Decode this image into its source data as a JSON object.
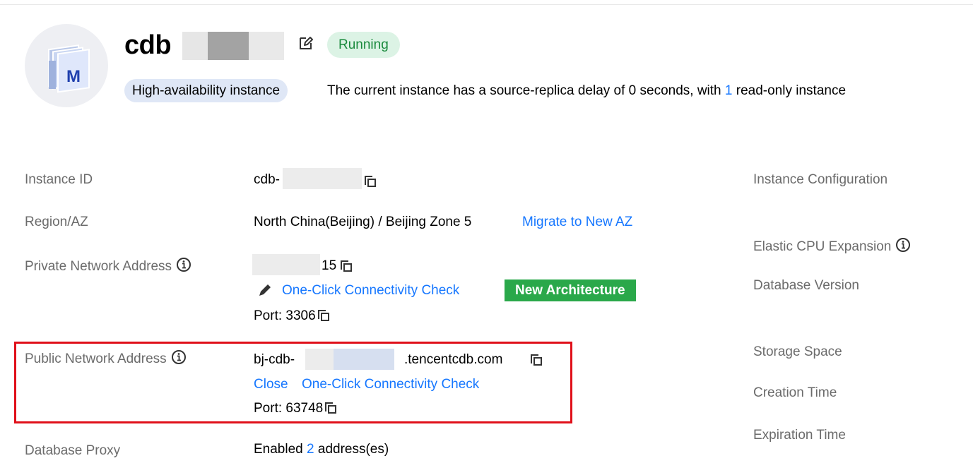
{
  "instance": {
    "name": "cdb",
    "status": "Running",
    "type_tag": "High-availability instance",
    "summary": {
      "text_before": "The current instance has a source-replica delay of  0  seconds, with ",
      "readonly_count": "1",
      "text_after": "  read-only instance"
    },
    "logo_letter": "M"
  },
  "details": {
    "instance_id": {
      "label": "Instance ID",
      "value": "cdb-"
    },
    "region": {
      "label": "Region/AZ",
      "value": "North China(Beijing) / Beijing Zone 5",
      "link": "Migrate to New AZ"
    },
    "private_network": {
      "label": "Private Network Address",
      "address_suffix": "15",
      "connectivity_link": "One-Click Connectivity Check",
      "badge": "New Architecture",
      "port": "Port: 3306"
    },
    "public_network": {
      "label": "Public Network Address",
      "address_prefix": "bj-cdb-",
      "address_suffix": ".tencentcdb.com",
      "close_link": "Close",
      "connectivity_link": "One-Click Connectivity Check",
      "port": "Port: 63748"
    },
    "database_proxy": {
      "label": "Database Proxy",
      "value_prefix": "Enabled",
      "count": "2",
      "value_suffix": "address(es)"
    }
  },
  "right_column": {
    "instance_configuration": "Instance Configuration",
    "elastic_cpu": "Elastic CPU Expansion",
    "database_version": "Database Version",
    "storage_space": "Storage Space",
    "creation_time": "Creation Time",
    "expiration_time": "Expiration Time"
  },
  "colors": {
    "accent_link": "#1677ff",
    "status_green": "#1a8a3d",
    "status_bg": "#dcf3e5",
    "badge_green": "#2aa84a",
    "highlight_red": "#e0101a",
    "tag_bg": "#dfe7f6"
  },
  "icons": [
    "edit-icon",
    "info-icon",
    "copy-icon",
    "pencil-icon",
    "mysql-instance-logo"
  ]
}
